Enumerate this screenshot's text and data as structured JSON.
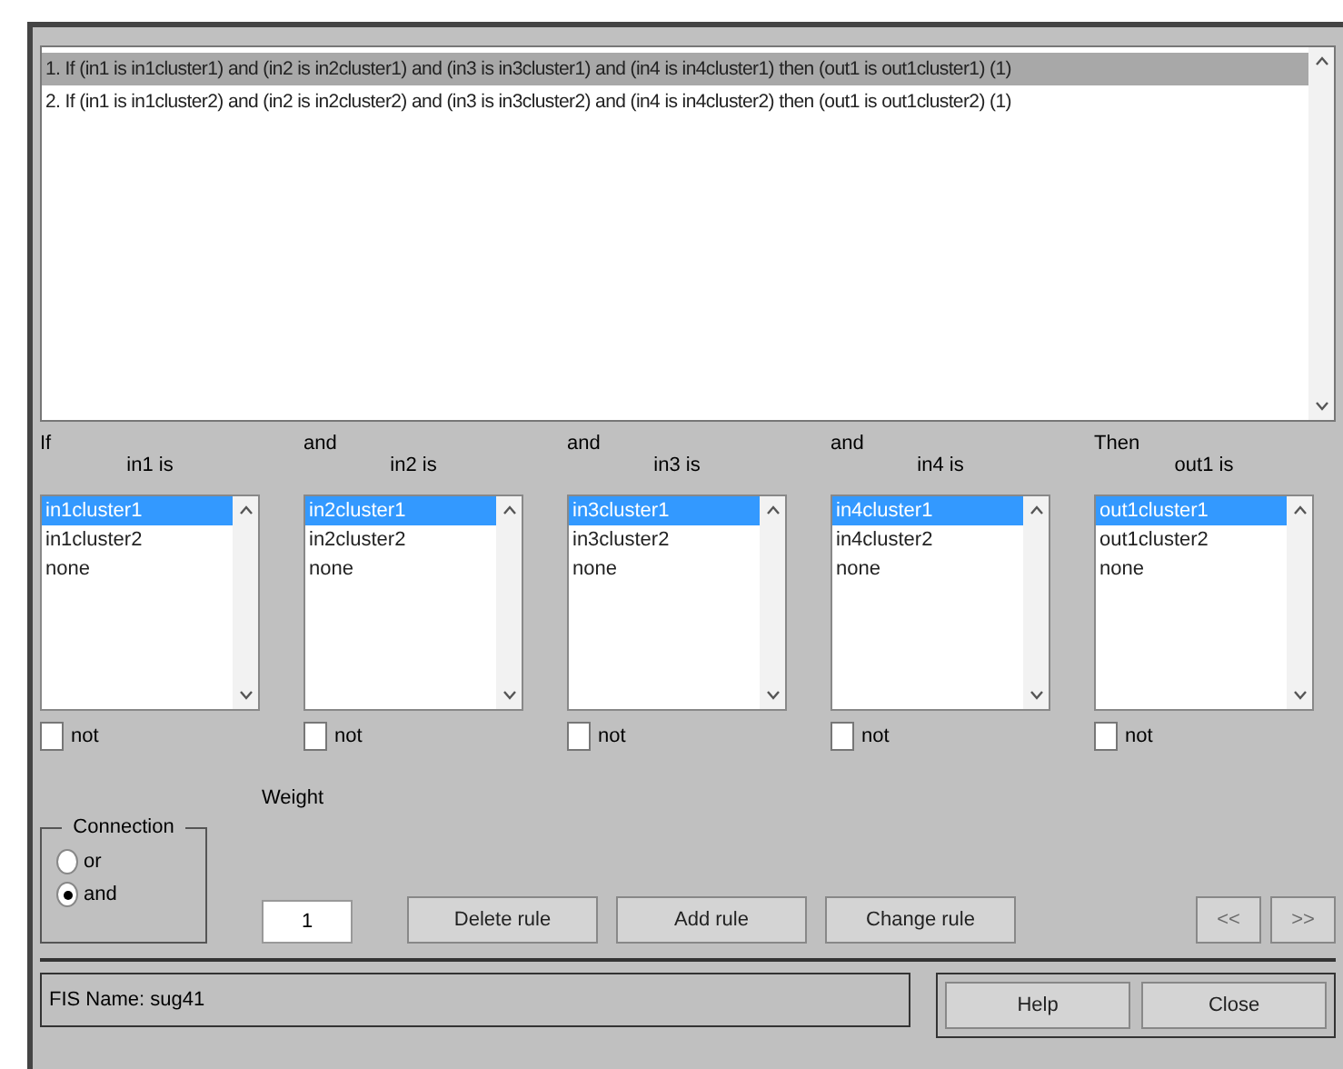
{
  "rules": [
    {
      "text": "1. If (in1 is in1cluster1) and (in2 is in2cluster1) and (in3 is in3cluster1) and (in4 is in4cluster1) then (out1 is out1cluster1) (1)",
      "selected": true
    },
    {
      "text": "2. If (in1 is in1cluster2) and (in2 is in2cluster2) and (in3 is in3cluster2) and (in4 is in4cluster2) then (out1 is out1cluster2) (1)",
      "selected": false
    }
  ],
  "variables": [
    {
      "connector": "If",
      "label": "in1 is",
      "options": [
        {
          "text": "in1cluster1",
          "selected": true
        },
        {
          "text": "in1cluster2",
          "selected": false
        },
        {
          "text": "none",
          "selected": false
        }
      ],
      "not_label": "not",
      "not_checked": false
    },
    {
      "connector": "and",
      "label": "in2 is",
      "options": [
        {
          "text": "in2cluster1",
          "selected": true
        },
        {
          "text": "in2cluster2",
          "selected": false
        },
        {
          "text": "none",
          "selected": false
        }
      ],
      "not_label": "not",
      "not_checked": false
    },
    {
      "connector": "and",
      "label": "in3 is",
      "options": [
        {
          "text": "in3cluster1",
          "selected": true
        },
        {
          "text": "in3cluster2",
          "selected": false
        },
        {
          "text": "none",
          "selected": false
        }
      ],
      "not_label": "not",
      "not_checked": false
    },
    {
      "connector": "and",
      "label": "in4 is",
      "options": [
        {
          "text": "in4cluster1",
          "selected": true
        },
        {
          "text": "in4cluster2",
          "selected": false
        },
        {
          "text": "none",
          "selected": false
        }
      ],
      "not_label": "not",
      "not_checked": false
    },
    {
      "connector": "Then",
      "label": "out1 is",
      "options": [
        {
          "text": "out1cluster1",
          "selected": true
        },
        {
          "text": "out1cluster2",
          "selected": false
        },
        {
          "text": "none",
          "selected": false
        }
      ],
      "not_label": "not",
      "not_checked": false
    }
  ],
  "connection": {
    "title": "Connection",
    "options": [
      {
        "label": "or",
        "selected": false
      },
      {
        "label": "and",
        "selected": true
      }
    ]
  },
  "weight": {
    "label": "Weight",
    "value": "1"
  },
  "rule_buttons": [
    "Delete rule",
    "Add rule",
    "Change rule"
  ],
  "nav_buttons": [
    {
      "label": "<<",
      "disabled": true
    },
    {
      "label": ">>",
      "disabled": true
    }
  ],
  "status": "FIS Name: sug41",
  "footer_buttons": [
    "Help",
    "Close"
  ]
}
